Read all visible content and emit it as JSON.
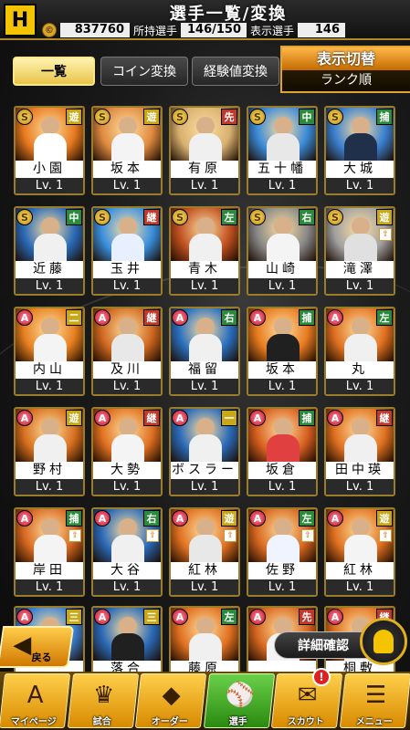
{
  "header": {
    "title": "選手一覧/変換",
    "logo": "H",
    "coins": "837760",
    "owned_label": "所持選手",
    "owned_value": "146/150",
    "shown_label": "表示選手",
    "shown_value": "146"
  },
  "tabs": [
    {
      "label": "一覧",
      "active": true
    },
    {
      "label": "コイン変換",
      "active": false
    },
    {
      "label": "経験値変換",
      "active": false
    }
  ],
  "display_switch": {
    "title": "表示切替",
    "sort": "ランク順"
  },
  "players": [
    {
      "name": "小園",
      "rank": "S",
      "pos": "遊",
      "pos_type": "yellow",
      "lv": "Lv. 1",
      "upgrade": false,
      "bg": "#e87a20",
      "uniform": "#ffffff"
    },
    {
      "name": "坂本",
      "rank": "S",
      "pos": "遊",
      "pos_type": "yellow",
      "lv": "Lv. 1",
      "upgrade": false,
      "bg": "#e08a40",
      "uniform": "#f4f4f4"
    },
    {
      "name": "有原",
      "rank": "S",
      "pos": "先",
      "pos_type": "pitcher",
      "lv": "Lv. 1",
      "upgrade": false,
      "bg": "#d8b070",
      "uniform": "#f0f0f0"
    },
    {
      "name": "五十幡",
      "rank": "S",
      "pos": "中",
      "pos_type": "batter",
      "lv": "Lv. 1",
      "upgrade": false,
      "bg": "#3a8ad8",
      "uniform": "#e8e8e8"
    },
    {
      "name": "大城",
      "rank": "S",
      "pos": "捕",
      "pos_type": "batter",
      "lv": "Lv. 1",
      "upgrade": false,
      "bg": "#3a80d0",
      "uniform": "#20304a"
    },
    {
      "name": "近藤",
      "rank": "S",
      "pos": "中",
      "pos_type": "batter",
      "lv": "Lv. 1",
      "upgrade": false,
      "bg": "#2a6ab8",
      "uniform": "#f0f0f0"
    },
    {
      "name": "玉井",
      "rank": "S",
      "pos": "継",
      "pos_type": "pitcher",
      "lv": "Lv. 1",
      "upgrade": false,
      "bg": "#3a90e0",
      "uniform": "#e8f0ff"
    },
    {
      "name": "青木",
      "rank": "S",
      "pos": "左",
      "pos_type": "batter",
      "lv": "Lv. 1",
      "upgrade": false,
      "bg": "#c05020",
      "uniform": "#f0f0f0"
    },
    {
      "name": "山崎",
      "rank": "S",
      "pos": "右",
      "pos_type": "batter",
      "lv": "Lv. 1",
      "upgrade": false,
      "bg": "#888888",
      "uniform": "#f4f4f4"
    },
    {
      "name": "滝澤",
      "rank": "S",
      "pos": "遊",
      "pos_type": "yellow",
      "lv": "Lv. 1",
      "upgrade": true,
      "bg": "#a0a0a0",
      "uniform": "#e0e0e0"
    },
    {
      "name": "内山",
      "rank": "A",
      "pos": "二",
      "pos_type": "yellow",
      "lv": "Lv. 1",
      "upgrade": false,
      "bg": "#e88020",
      "uniform": "#f4f4f4"
    },
    {
      "name": "及川",
      "rank": "A",
      "pos": "継",
      "pos_type": "pitcher",
      "lv": "Lv. 1",
      "upgrade": false,
      "bg": "#d06820",
      "uniform": "#e8e8e8"
    },
    {
      "name": "福留",
      "rank": "A",
      "pos": "右",
      "pos_type": "batter",
      "lv": "Lv. 1",
      "upgrade": false,
      "bg": "#2a70c0",
      "uniform": "#f0f0f0"
    },
    {
      "name": "坂本",
      "rank": "A",
      "pos": "捕",
      "pos_type": "batter",
      "lv": "Lv. 1",
      "upgrade": false,
      "bg": "#e87a20",
      "uniform": "#202020"
    },
    {
      "name": "丸",
      "rank": "A",
      "pos": "左",
      "pos_type": "batter",
      "lv": "Lv. 1",
      "upgrade": false,
      "bg": "#e07020",
      "uniform": "#f0f0f0"
    },
    {
      "name": "野村",
      "rank": "A",
      "pos": "遊",
      "pos_type": "yellow",
      "lv": "Lv. 1",
      "upgrade": false,
      "bg": "#d87020",
      "uniform": "#f0f0f0"
    },
    {
      "name": "大勢",
      "rank": "A",
      "pos": "継",
      "pos_type": "pitcher",
      "lv": "Lv. 1",
      "upgrade": false,
      "bg": "#e07020",
      "uniform": "#f4f4f4"
    },
    {
      "name": "ボスラー",
      "rank": "A",
      "pos": "一",
      "pos_type": "yellow",
      "lv": "Lv. 1",
      "upgrade": false,
      "bg": "#2a6ab8",
      "uniform": "#f0f0f0"
    },
    {
      "name": "坂倉",
      "rank": "A",
      "pos": "捕",
      "pos_type": "batter",
      "lv": "Lv. 1",
      "upgrade": false,
      "bg": "#d86020",
      "uniform": "#e04040"
    },
    {
      "name": "田中瑛",
      "rank": "A",
      "pos": "継",
      "pos_type": "pitcher",
      "lv": "Lv. 1",
      "upgrade": false,
      "bg": "#e07020",
      "uniform": "#f0f0f0"
    },
    {
      "name": "岸田",
      "rank": "A",
      "pos": "捕",
      "pos_type": "batter",
      "lv": "Lv. 1",
      "upgrade": true,
      "bg": "#d86820",
      "uniform": "#f4f4f4"
    },
    {
      "name": "大谷",
      "rank": "A",
      "pos": "右",
      "pos_type": "batter",
      "lv": "Lv. 1",
      "upgrade": true,
      "bg": "#2a6ab8",
      "uniform": "#f0f0f0"
    },
    {
      "name": "紅林",
      "rank": "A",
      "pos": "遊",
      "pos_type": "yellow",
      "lv": "Lv. 1",
      "upgrade": true,
      "bg": "#e07020",
      "uniform": "#e8e8e8"
    },
    {
      "name": "佐野",
      "rank": "A",
      "pos": "左",
      "pos_type": "batter",
      "lv": "Lv. 1",
      "upgrade": true,
      "bg": "#d86820",
      "uniform": "#f0f4ff"
    },
    {
      "name": "紅林",
      "rank": "A",
      "pos": "遊",
      "pos_type": "yellow",
      "lv": "Lv. 1",
      "upgrade": true,
      "bg": "#e07020",
      "uniform": "#f4f4f4"
    },
    {
      "name": "",
      "rank": "A",
      "pos": "三",
      "pos_type": "yellow",
      "lv": "",
      "upgrade": false,
      "bg": "#3a80d0",
      "uniform": "#f0f0f0"
    },
    {
      "name": "落合",
      "rank": "A",
      "pos": "三",
      "pos_type": "yellow",
      "lv": "",
      "upgrade": false,
      "bg": "#2a6ab8",
      "uniform": "#202020"
    },
    {
      "name": "藤原",
      "rank": "A",
      "pos": "左",
      "pos_type": "batter",
      "lv": "",
      "upgrade": false,
      "bg": "#e07020",
      "uniform": "#f0f0f0"
    },
    {
      "name": "",
      "rank": "A",
      "pos": "先",
      "pos_type": "pitcher",
      "lv": "",
      "upgrade": false,
      "bg": "#d86820",
      "uniform": "#f4f4f4"
    },
    {
      "name": "桐敷",
      "rank": "A",
      "pos": "継",
      "pos_type": "pitcher",
      "lv": "",
      "upgrade": false,
      "bg": "#e07020",
      "uniform": "#f0f0f0"
    }
  ],
  "bottom": {
    "back_label": "戻る",
    "detail_label": "詳細確認",
    "badge": "!"
  },
  "nav": [
    {
      "label": "マイページ",
      "icon": "home-icon",
      "glyph": "A",
      "active": false
    },
    {
      "label": "試合",
      "icon": "trophy-icon",
      "glyph": "♛",
      "active": false
    },
    {
      "label": "オーダー",
      "icon": "field-icon",
      "glyph": "◆",
      "active": false
    },
    {
      "label": "選手",
      "icon": "player-icon",
      "glyph": "⚾",
      "active": true
    },
    {
      "label": "スカウト",
      "icon": "scout-icon",
      "glyph": "✉",
      "active": false
    },
    {
      "label": "メニュー",
      "icon": "menu-icon",
      "glyph": "☰",
      "active": false
    }
  ]
}
